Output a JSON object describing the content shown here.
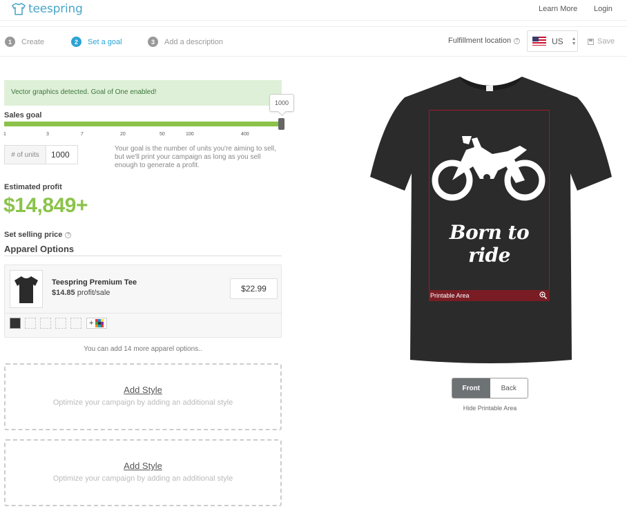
{
  "header": {
    "brand": "teespring",
    "learn_more": "Learn More",
    "login": "Login"
  },
  "steps": [
    {
      "num": "1",
      "label": "Create"
    },
    {
      "num": "2",
      "label": "Set a goal"
    },
    {
      "num": "3",
      "label": "Add a description"
    }
  ],
  "fulfillment": {
    "label": "Fulfillment location",
    "help": "?",
    "country": "US",
    "save": "Save"
  },
  "alert": "Vector graphics detected. Goal of One enabled!",
  "sales_goal": {
    "label": "Sales goal",
    "value": "1000",
    "ticks": [
      "1",
      "3",
      "7",
      "20",
      "50",
      "100",
      "400"
    ],
    "units_label": "# of units",
    "units_value": "1000",
    "help_text": "Your goal is the number of units you're aiming to sell, but we'll print your campaign as long as you sell enough to generate a profit."
  },
  "profit": {
    "label": "Estimated profit",
    "value": "$14,849+"
  },
  "selling_price": {
    "label": "Set selling price",
    "help": "?"
  },
  "apparel": {
    "title": "Apparel Options",
    "name": "Teespring Premium Tee",
    "profit_amount": "$14.85",
    "profit_suffix": " profit/sale",
    "price": "$22.99",
    "add_color_glyph": "+",
    "more_options": "You can add 14 more apparel options.."
  },
  "add_styles": [
    {
      "link": "Add Style",
      "sub": "Optimize your campaign by adding an additional style"
    },
    {
      "link": "Add Style",
      "sub": "Optimize your campaign by adding an additional style"
    }
  ],
  "preview": {
    "design_text": "Born to ride",
    "printable_label": "Printable Area",
    "front": "Front",
    "back": "Back",
    "hide_printable": "Hide Printable Area"
  },
  "colors": {
    "accent": "#2aa3d4",
    "profit_green": "#8bc34a",
    "shirt": "#2b2b2b",
    "printable_border": "#a01a2a"
  }
}
